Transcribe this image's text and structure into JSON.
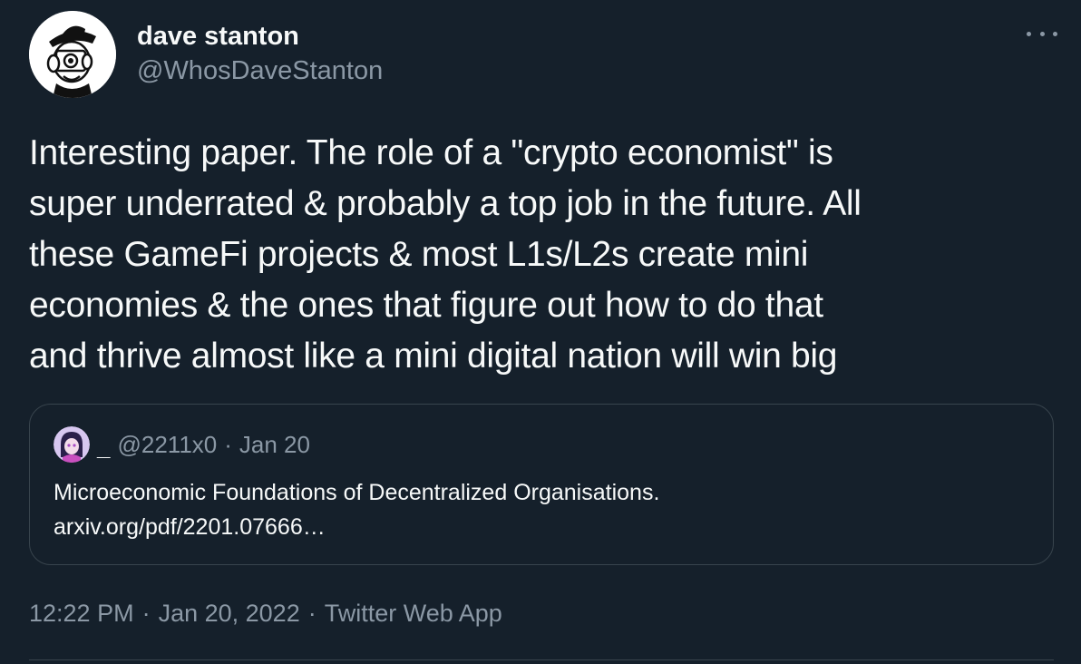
{
  "author": {
    "display_name": "dave stanton",
    "handle": "@WhosDaveStanton"
  },
  "more_icon": "more-horizontal-icon",
  "tweet_lines": [
    "Interesting paper. The role of a \"crypto economist\" is",
    "super underrated & probably a top job in the future. All",
    "these GameFi projects & most L1s/L2s create mini",
    "economies & the ones that figure out how to do that",
    "and thrive almost like a mini digital nation will win big"
  ],
  "quote": {
    "name": "_",
    "handle": "@2211x0",
    "separator": "·",
    "date": "Jan 20",
    "text": "Microeconomic Foundations of Decentralized Organisations.",
    "link": "arxiv.org/pdf/2201.07666…"
  },
  "meta": {
    "time": "12:22 PM",
    "separator": "·",
    "date": "Jan 20, 2022",
    "source": "Twitter Web App"
  },
  "colors": {
    "background": "#15202b",
    "text": "#f7f9f9",
    "secondary": "#8b98a5",
    "border": "#38444d"
  }
}
